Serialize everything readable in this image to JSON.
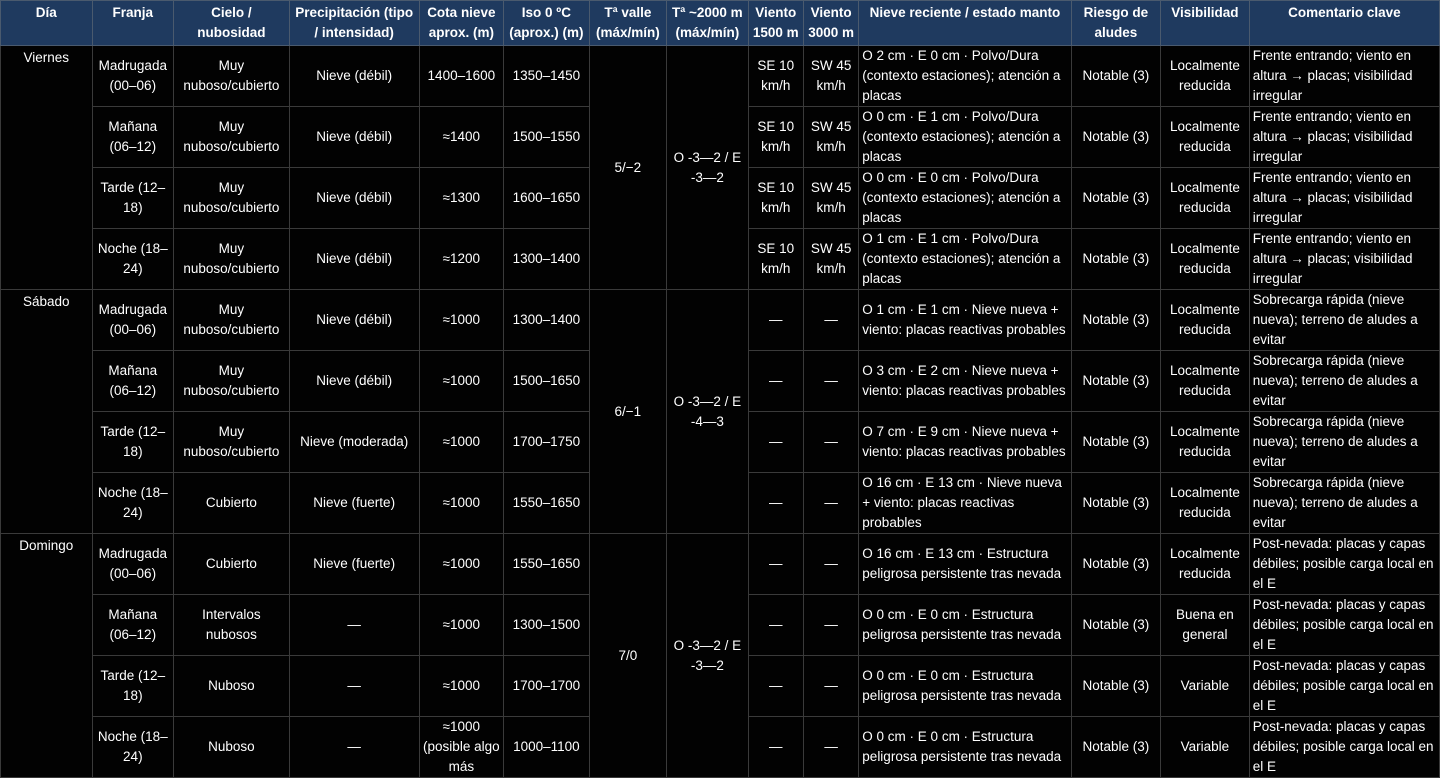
{
  "headers": {
    "dia": "Día",
    "franja": "Franja",
    "cielo": "Cielo / nubosidad",
    "precip": "Precipitación (tipo / intensidad)",
    "cota": "Cota nieve aprox. (m)",
    "iso": "Iso 0 ºC (aprox.) (m)",
    "tvalle": "Tª valle (máx/mín)",
    "t2000": "Tª ~2000 m (máx/mín)",
    "v1500": "Viento 1500 m",
    "v3000": "Viento 3000 m",
    "nieve": "Nieve reciente / estado manto",
    "riesgo": "Riesgo de aludes",
    "visib": "Visibilidad",
    "coment": "Comentario clave"
  },
  "days": [
    {
      "name": "Viernes",
      "tvalle": "5/−2",
      "t2000": "O -3—2 / E -3—2",
      "rows": [
        {
          "franja": "Madrugada (00–06)",
          "cielo": "Muy nuboso/cubierto",
          "precip": "Nieve (débil)",
          "cota": "1400–1600",
          "iso": "1350–1450",
          "v1500": "SE 10 km/h",
          "v3000": "SW 45 km/h",
          "nieve": "O 2 cm · E 0 cm · Polvo/Dura (contexto estaciones); atención a placas",
          "riesgo": "Notable (3)",
          "visib": "Localmente reducida",
          "coment": "Frente entrando; viento en altura → placas; visibilidad irregular"
        },
        {
          "franja": "Mañana (06–12)",
          "cielo": "Muy nuboso/cubierto",
          "precip": "Nieve (débil)",
          "cota": "≈1400",
          "iso": "1500–1550",
          "v1500": "SE 10 km/h",
          "v3000": "SW 45 km/h",
          "nieve": "O 0 cm · E 1 cm · Polvo/Dura (contexto estaciones); atención a placas",
          "riesgo": "Notable (3)",
          "visib": "Localmente reducida",
          "coment": "Frente entrando; viento en altura → placas; visibilidad irregular"
        },
        {
          "franja": "Tarde (12–18)",
          "cielo": "Muy nuboso/cubierto",
          "precip": "Nieve (débil)",
          "cota": "≈1300",
          "iso": "1600–1650",
          "v1500": "SE 10 km/h",
          "v3000": "SW 45 km/h",
          "nieve": "O 0 cm · E 0 cm · Polvo/Dura (contexto estaciones); atención a placas",
          "riesgo": "Notable (3)",
          "visib": "Localmente reducida",
          "coment": "Frente entrando; viento en altura → placas; visibilidad irregular"
        },
        {
          "franja": "Noche (18–24)",
          "cielo": "Muy nuboso/cubierto",
          "precip": "Nieve (débil)",
          "cota": "≈1200",
          "iso": "1300–1400",
          "v1500": "SE 10 km/h",
          "v3000": "SW 45 km/h",
          "nieve": "O 1 cm · E 1 cm · Polvo/Dura (contexto estaciones); atención a placas",
          "riesgo": "Notable (3)",
          "visib": "Localmente reducida",
          "coment": "Frente entrando; viento en altura → placas; visibilidad irregular"
        }
      ]
    },
    {
      "name": "Sábado",
      "tvalle": "6/−1",
      "t2000": "O -3—2 / E -4—3",
      "rows": [
        {
          "franja": "Madrugada (00–06)",
          "cielo": "Muy nuboso/cubierto",
          "precip": "Nieve (débil)",
          "cota": "≈1000",
          "iso": "1300–1400",
          "v1500": "—",
          "v3000": "—",
          "nieve": "O 1 cm · E 1 cm · Nieve nueva + viento: placas reactivas probables",
          "riesgo": "Notable (3)",
          "visib": "Localmente reducida",
          "coment": "Sobrecarga rápida (nieve nueva); terreno de aludes a evitar"
        },
        {
          "franja": "Mañana (06–12)",
          "cielo": "Muy nuboso/cubierto",
          "precip": "Nieve (débil)",
          "cota": "≈1000",
          "iso": "1500–1650",
          "v1500": "—",
          "v3000": "—",
          "nieve": "O 3 cm · E 2 cm · Nieve nueva + viento: placas reactivas probables",
          "riesgo": "Notable (3)",
          "visib": "Localmente reducida",
          "coment": "Sobrecarga rápida (nieve nueva); terreno de aludes a evitar"
        },
        {
          "franja": "Tarde (12–18)",
          "cielo": "Muy nuboso/cubierto",
          "precip": "Nieve (moderada)",
          "cota": "≈1000",
          "iso": "1700–1750",
          "v1500": "—",
          "v3000": "—",
          "nieve": "O 7 cm · E 9 cm · Nieve nueva + viento: placas reactivas probables",
          "riesgo": "Notable (3)",
          "visib": "Localmente reducida",
          "coment": "Sobrecarga rápida (nieve nueva); terreno de aludes a evitar"
        },
        {
          "franja": "Noche (18–24)",
          "cielo": "Cubierto",
          "precip": "Nieve (fuerte)",
          "cota": "≈1000",
          "iso": "1550–1650",
          "v1500": "—",
          "v3000": "—",
          "nieve": "O 16 cm · E 13 cm · Nieve nueva + viento: placas reactivas probables",
          "riesgo": "Notable (3)",
          "visib": "Localmente reducida",
          "coment": "Sobrecarga rápida (nieve nueva); terreno de aludes a evitar"
        }
      ]
    },
    {
      "name": "Domingo",
      "tvalle": "7/0",
      "t2000": "O -3—2 / E -3—2",
      "rows": [
        {
          "franja": "Madrugada (00–06)",
          "cielo": "Cubierto",
          "precip": "Nieve (fuerte)",
          "cota": "≈1000",
          "iso": "1550–1650",
          "v1500": "—",
          "v3000": "—",
          "nieve": "O 16 cm · E 13 cm · Estructura peligrosa persistente tras nevada",
          "riesgo": "Notable (3)",
          "visib": "Localmente reducida",
          "coment": "Post-nevada: placas y capas débiles; posible carga local en el E"
        },
        {
          "franja": "Mañana (06–12)",
          "cielo": "Intervalos nubosos",
          "precip": "—",
          "cota": "≈1000",
          "iso": "1300–1500",
          "v1500": "—",
          "v3000": "—",
          "nieve": "O 0 cm · E 0 cm · Estructura peligrosa persistente tras nevada",
          "riesgo": "Notable (3)",
          "visib": "Buena en general",
          "coment": "Post-nevada: placas y capas débiles; posible carga local en el E"
        },
        {
          "franja": "Tarde (12–18)",
          "cielo": "Nuboso",
          "precip": "—",
          "cota": "≈1000",
          "iso": "1700–1700",
          "v1500": "—",
          "v3000": "—",
          "nieve": "O 0 cm · E 0 cm · Estructura peligrosa persistente tras nevada",
          "riesgo": "Notable (3)",
          "visib": "Variable",
          "coment": "Post-nevada: placas y capas débiles; posible carga local en el E"
        },
        {
          "franja": "Noche (18–24)",
          "cielo": "Nuboso",
          "precip": "—",
          "cota": "≈1000 (posible algo más",
          "iso": "1000–1100",
          "v1500": "—",
          "v3000": "—",
          "nieve": "O 0 cm · E 0 cm · Estructura peligrosa persistente tras nevada",
          "riesgo": "Notable (3)",
          "visib": "Variable",
          "coment": "Post-nevada: placas y capas débiles; posible carga local en el E"
        }
      ]
    }
  ]
}
